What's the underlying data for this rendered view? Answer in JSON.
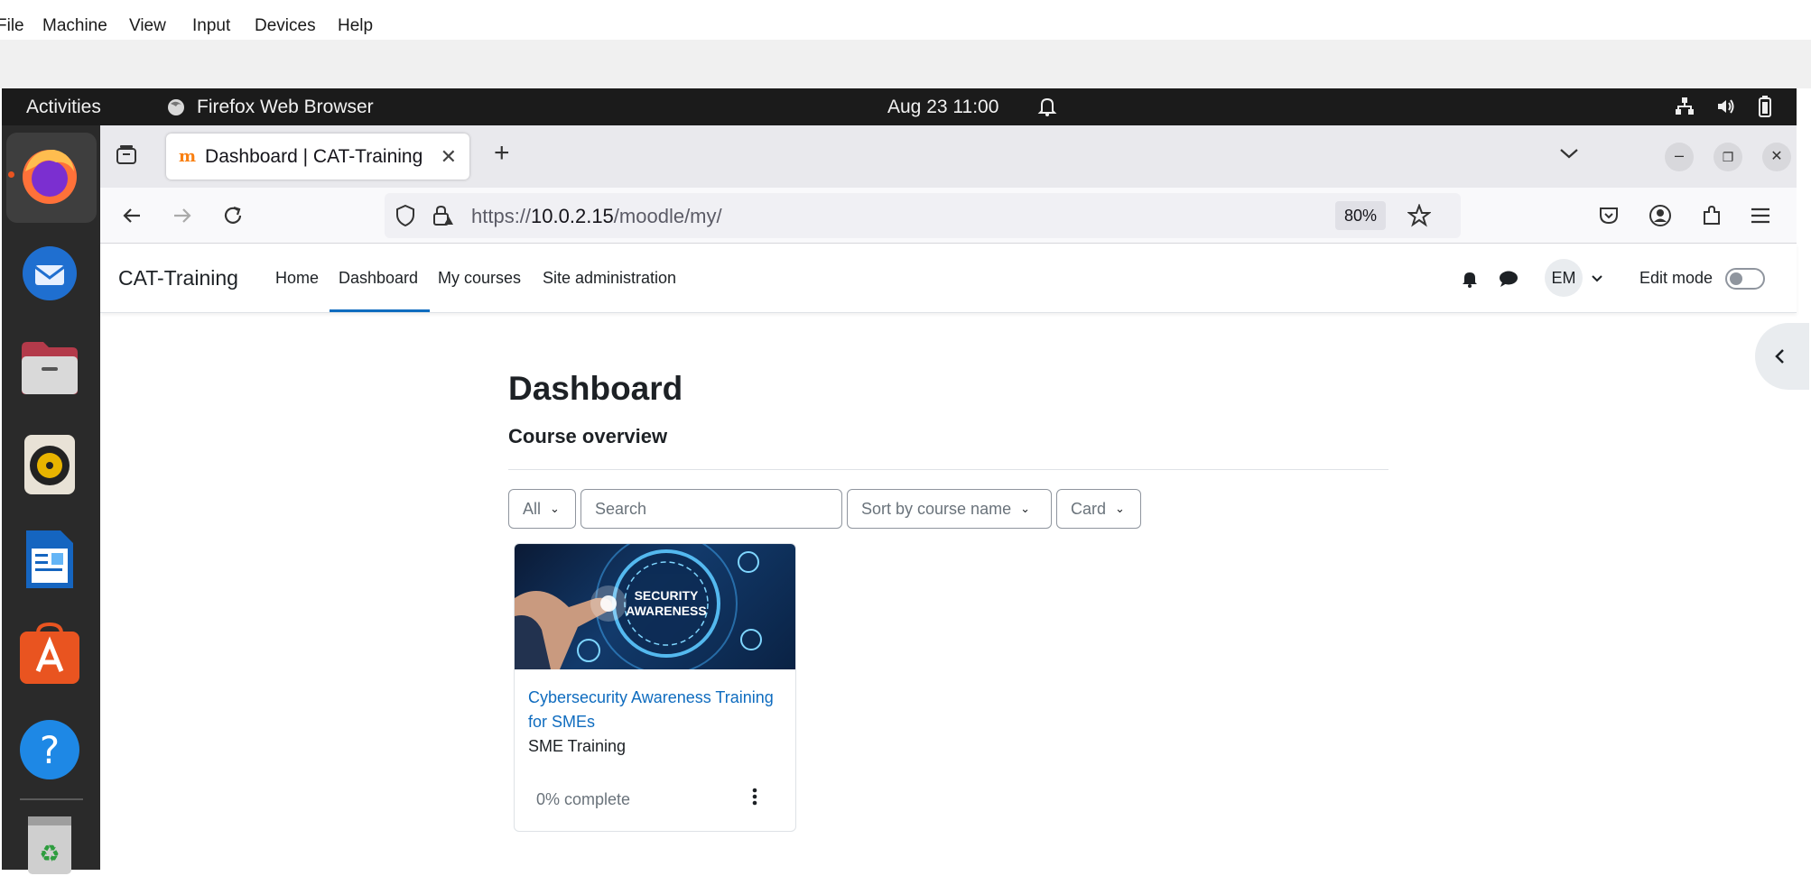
{
  "host_menu": {
    "items": [
      "File",
      "Machine",
      "View",
      "Input",
      "Devices",
      "Help"
    ]
  },
  "topbar": {
    "activities": "Activities",
    "app_name": "Firefox Web Browser",
    "clock": "Aug 23  11:00"
  },
  "dock": {
    "apps": [
      "firefox-icon",
      "thunderbird-icon",
      "files-icon",
      "rhythmbox-icon",
      "writer-icon",
      "app-center-icon",
      "help-icon",
      "trash-icon"
    ]
  },
  "browser": {
    "tab_title": "Dashboard | CAT-Training",
    "url_prefix": "https://",
    "url_host": "10.0.2.15",
    "url_path": "/moodle/my/",
    "zoom": "80%"
  },
  "moodle_nav": {
    "brand": "CAT-Training",
    "links": [
      "Home",
      "Dashboard",
      "My courses",
      "Site administration"
    ],
    "active": "Dashboard",
    "avatar_initials": "EM",
    "edit_mode_label": "Edit mode",
    "edit_mode_on": false
  },
  "main": {
    "page_title": "Dashboard",
    "section_title": "Course overview",
    "filters": {
      "grouping": "All",
      "search_placeholder": "Search",
      "sort": "Sort by course name",
      "view": "Card"
    },
    "courses": [
      {
        "image_text_line1": "SECURITY",
        "image_text_line2": "AWARENESS",
        "name": "Cybersecurity Awareness Training for SMEs",
        "category": "SME Training",
        "progress": "0% complete"
      }
    ]
  },
  "colors": {
    "moodle_blue": "#0f6cbf",
    "ubuntu_orange": "#e95420",
    "topbar_bg": "#1b1b1b"
  }
}
